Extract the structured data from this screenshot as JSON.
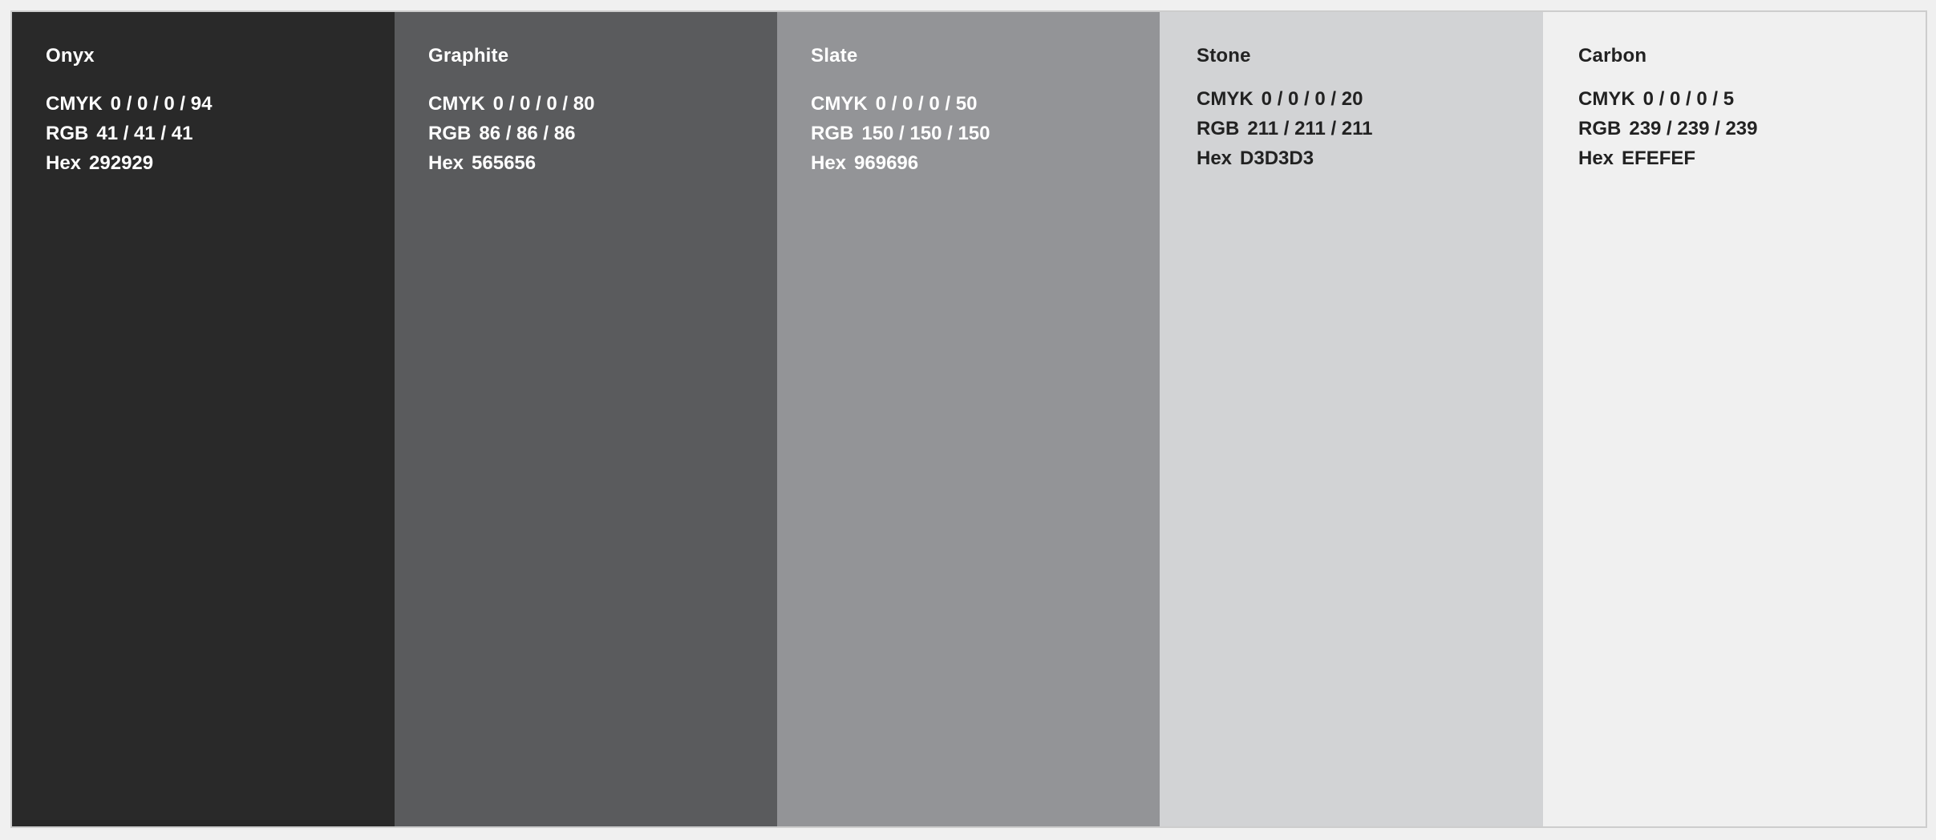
{
  "swatches": [
    {
      "name": "Onyx",
      "color": "#292929",
      "text_color": "#ffffff",
      "cmyk_label": "CMYK",
      "cmyk": "0 / 0 / 0 / 94",
      "rgb_label": "RGB",
      "rgb": "41 / 41 / 41",
      "hex_label": "Hex",
      "hex": "292929"
    },
    {
      "name": "Graphite",
      "color": "#5a5b5d",
      "text_color": "#ffffff",
      "cmyk_label": "CMYK",
      "cmyk": "0 / 0 / 0 / 80",
      "rgb_label": "RGB",
      "rgb": "86 / 86 / 86",
      "hex_label": "Hex",
      "hex": "565656"
    },
    {
      "name": "Slate",
      "color": "#939497",
      "text_color": "#ffffff",
      "cmyk_label": "CMYK",
      "cmyk": "0 / 0 / 0 / 50",
      "rgb_label": "RGB",
      "rgb": "150 / 150 / 150",
      "hex_label": "Hex",
      "hex": "969696"
    },
    {
      "name": "Stone",
      "color": "#d2d3d5",
      "text_color": "#222222",
      "cmyk_label": "CMYK",
      "cmyk": "0 / 0 / 0 / 20",
      "rgb_label": "RGB",
      "rgb": "211 / 211 / 211",
      "hex_label": "Hex",
      "hex": "D3D3D3"
    },
    {
      "name": "Carbon",
      "color": "#f0f0f0",
      "text_color": "#222222",
      "cmyk_label": "CMYK",
      "cmyk": "0 / 0 / 0 / 5",
      "rgb_label": "RGB",
      "rgb": "239 / 239 / 239",
      "hex_label": "Hex",
      "hex": "EFEFEF"
    }
  ]
}
